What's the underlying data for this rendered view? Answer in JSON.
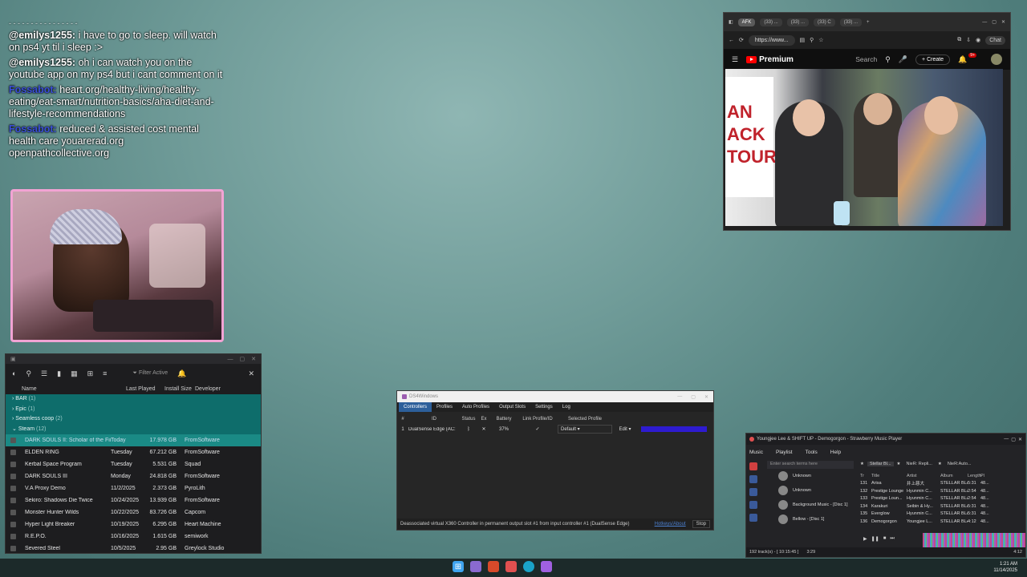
{
  "chat": {
    "messages": [
      {
        "user": "@emilys1255:",
        "text": "i have to go to sleep. will watch on ps4 yt til i sleep :>",
        "bot": false
      },
      {
        "user": "@emilys1255:",
        "text": "oh i can watch you on the youtube app on my ps4 but i cant comment on it",
        "bot": false
      },
      {
        "user": "Fossabot:",
        "text": "heart.org/healthy-living/healthy-eating/eat-smart/nutrition-basics/aha-diet-and-lifestyle-recommendations",
        "bot": true
      },
      {
        "user": "Fossabot:",
        "text": "reduced & assisted cost mental health care youarerad.org openpathcollective.org",
        "bot": true
      }
    ],
    "colors": {
      "text": "#ffffff",
      "bot": "#3a4fd8",
      "webcam_border": "#f2a3d4"
    }
  },
  "launcher": {
    "filter_label": "Filter Active",
    "columns": [
      "Name",
      "Last Played",
      "Install Size",
      "Developer"
    ],
    "groups": [
      {
        "name": "BAR",
        "count": "(1)"
      },
      {
        "name": "Epic",
        "count": "(1)"
      },
      {
        "name": "Seamless coop",
        "count": "(2)"
      },
      {
        "name": "Steam",
        "count": "(12)"
      }
    ],
    "games": [
      {
        "name": "DARK SOULS II: Scholar of the First Sin",
        "last_played": "Today",
        "size": "17.978 GB",
        "dev": "FromSoftware",
        "selected": true
      },
      {
        "name": "ELDEN RING",
        "last_played": "Tuesday",
        "size": "67.212 GB",
        "dev": "FromSoftware",
        "selected": false
      },
      {
        "name": "Kerbal Space Program",
        "last_played": "Tuesday",
        "size": "5.531 GB",
        "dev": "Squad",
        "selected": false
      },
      {
        "name": "DARK SOULS III",
        "last_played": "Monday",
        "size": "24.818 GB",
        "dev": "FromSoftware",
        "selected": false
      },
      {
        "name": "V.A Proxy Demo",
        "last_played": "11/2/2025",
        "size": "2.373 GB",
        "dev": "PyroLith",
        "selected": false
      },
      {
        "name": "Sekiro: Shadows Die Twice",
        "last_played": "10/24/2025",
        "size": "13.939 GB",
        "dev": "FromSoftware",
        "selected": false
      },
      {
        "name": "Monster Hunter Wilds",
        "last_played": "10/22/2025",
        "size": "83.726 GB",
        "dev": "Capcom",
        "selected": false
      },
      {
        "name": "Hyper Light Breaker",
        "last_played": "10/19/2025",
        "size": "6.295 GB",
        "dev": "Heart Machine",
        "selected": false
      },
      {
        "name": "R.E.P.O.",
        "last_played": "10/16/2025",
        "size": "1.615 GB",
        "dev": "semiwork",
        "selected": false
      },
      {
        "name": "Severed Steel",
        "last_played": "10/5/2025",
        "size": "2.95 GB",
        "dev": "Greylock Studio",
        "selected": false
      }
    ],
    "colors": {
      "group_bg": "#0e6d6b",
      "selected_bg": "#1a8a85"
    }
  },
  "browser": {
    "tabs": [
      "AFK",
      "(33) ...",
      "(33) ...",
      "(33) C",
      "(33) ..."
    ],
    "url": "https://www...",
    "chat_label": "Chat",
    "yt_brand": "Premium",
    "search_placeholder": "Search",
    "create_label": "Create",
    "notif_count": "9+",
    "video_banner_text": "AN ACK TOUR"
  },
  "ds4": {
    "title": "DS4Windows",
    "tabs": [
      "Controllers",
      "Profiles",
      "Auto Profiles",
      "Output Slots",
      "Settings",
      "Log"
    ],
    "headers": [
      "#",
      "ID",
      "Status",
      "Ex",
      "Battery",
      "Link Profile/ID",
      "Selected Profile"
    ],
    "controller": {
      "num": "1",
      "id": "DualSense Edge (AC:",
      "status_icon": "bluetooth-icon",
      "ex": "✕",
      "battery": "37%",
      "link": "✓",
      "profile": "Default",
      "edit": "Edit",
      "light_color": "#2e1bd0"
    },
    "status_message": "Deassociated virtual X360 Controller in permanent output slot #1 from input controller #1 (DualSense Edge)",
    "hotkeys_label": "Hotkeys/About",
    "stop_label": "Stop",
    "active_tab_color": "#2d5f9a"
  },
  "music": {
    "title": "Youngjee Lee & SHIFT UP - Demogorgon - Strawberry Music Player",
    "menu": [
      "Music",
      "Playlist",
      "Tools",
      "Help"
    ],
    "search_placeholder": "Enter search terms here",
    "library": [
      {
        "label": "Unknown"
      },
      {
        "label": "Unknown"
      },
      {
        "label": "Background Music - [Disc 1]"
      },
      {
        "label": "Bellow - [Disc 1]"
      }
    ],
    "playlist_tabs": [
      "Stellar Bl...",
      "NieR: Repli...",
      "NieR:Auto..."
    ],
    "columns": [
      "Tr",
      "Title",
      "Artist",
      "Album",
      "Length",
      "Pl"
    ],
    "tracks": [
      {
        "tr": "131",
        "title": "Arisa",
        "artist": "井上慈大",
        "album": "STELLAR BLAD...",
        "len": "5:31",
        "pl": "48..."
      },
      {
        "tr": "132",
        "title": "Prestige Lounge",
        "artist": "Hyunmin C...",
        "album": "STELLAR BLAD...",
        "len": "2:54",
        "pl": "48..."
      },
      {
        "tr": "133",
        "title": "Prestige Loun...",
        "artist": "Hyunmin C...",
        "album": "STELLAR BLAD...",
        "len": "2:54",
        "pl": "48..."
      },
      {
        "tr": "134",
        "title": "Karakuri",
        "artist": "Seibin & Hy...",
        "album": "STELLAR BLAD...",
        "len": "5:31",
        "pl": "48..."
      },
      {
        "tr": "135",
        "title": "Everglow",
        "artist": "Hyunmin C...",
        "album": "STELLAR BLAD...",
        "len": "5:31",
        "pl": "48..."
      },
      {
        "tr": "136",
        "title": "Demogorgon",
        "artist": "Youngjee L...",
        "album": "STELLAR BLAD...",
        "len": "4:12",
        "pl": "48..."
      }
    ],
    "status": "192 track(s) - [ 10:15:45 ]",
    "position": "3:29",
    "length": "4:12"
  },
  "taskbar": {
    "time": "1:21 AM",
    "date": "11/14/2025"
  }
}
